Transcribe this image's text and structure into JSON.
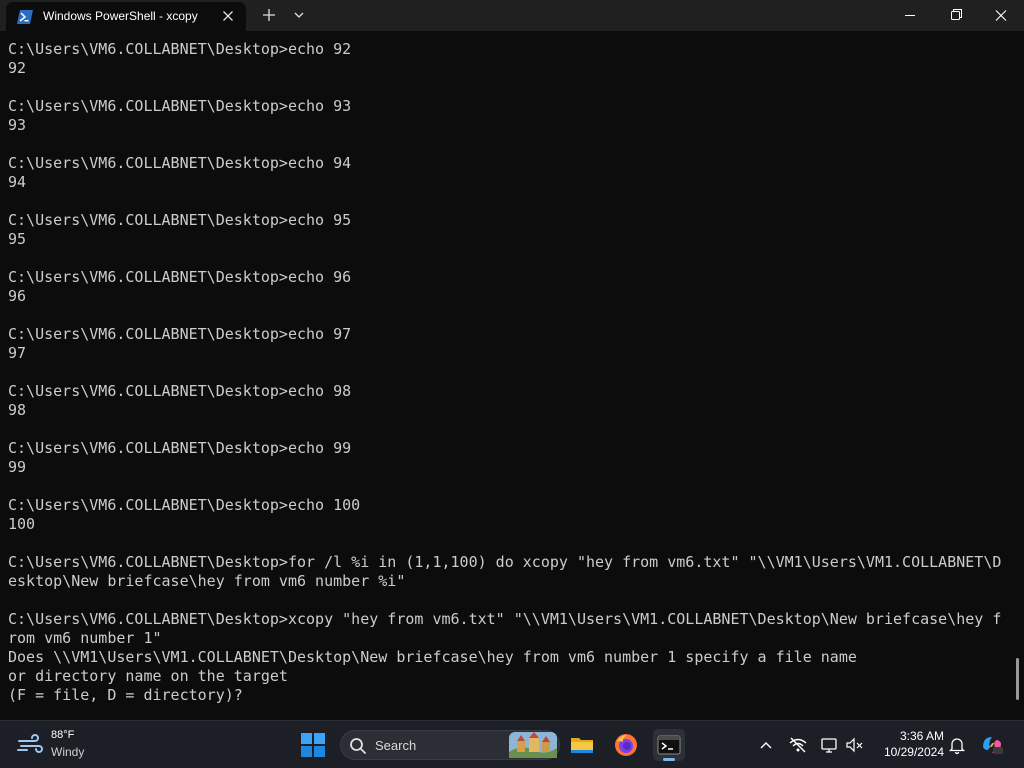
{
  "window": {
    "tab_title": "Windows PowerShell - xcopy",
    "new_tab_symbol": "+",
    "dropdown_symbol": "⌄"
  },
  "terminal": {
    "lines": [
      "C:\\Users\\VM6.COLLABNET\\Desktop>echo 92",
      "92",
      "",
      "C:\\Users\\VM6.COLLABNET\\Desktop>echo 93",
      "93",
      "",
      "C:\\Users\\VM6.COLLABNET\\Desktop>echo 94",
      "94",
      "",
      "C:\\Users\\VM6.COLLABNET\\Desktop>echo 95",
      "95",
      "",
      "C:\\Users\\VM6.COLLABNET\\Desktop>echo 96",
      "96",
      "",
      "C:\\Users\\VM6.COLLABNET\\Desktop>echo 97",
      "97",
      "",
      "C:\\Users\\VM6.COLLABNET\\Desktop>echo 98",
      "98",
      "",
      "C:\\Users\\VM6.COLLABNET\\Desktop>echo 99",
      "99",
      "",
      "C:\\Users\\VM6.COLLABNET\\Desktop>echo 100",
      "100",
      "",
      "C:\\Users\\VM6.COLLABNET\\Desktop>for /l %i in (1,1,100) do xcopy \"hey from vm6.txt\" \"\\\\VM1\\Users\\VM1.COLLABNET\\D",
      "esktop\\New briefcase\\hey from vm6 number %i\"",
      "",
      "C:\\Users\\VM6.COLLABNET\\Desktop>xcopy \"hey from vm6.txt\" \"\\\\VM1\\Users\\VM1.COLLABNET\\Desktop\\New briefcase\\hey f",
      "rom vm6 number 1\"",
      "Does \\\\VM1\\Users\\VM1.COLLABNET\\Desktop\\New briefcase\\hey from vm6 number 1 specify a file name",
      "or directory name on the target",
      "(F = file, D = directory)?"
    ]
  },
  "taskbar": {
    "weather": {
      "temp": "88°F",
      "condition": "Windy"
    },
    "search_placeholder": "Search",
    "clock": {
      "time": "3:36 AM",
      "date": "10/29/2024"
    },
    "apps": [
      "start-icon",
      "file-explorer-icon",
      "firefox-icon",
      "terminal-icon"
    ],
    "tray_icons": [
      "chevron-up-icon",
      "network-off-icon",
      "display-icon",
      "volume-muted-icon",
      "bell-icon",
      "copilot-icon"
    ]
  },
  "colors": {
    "terminal_bg": "#0c0c0c",
    "terminal_fg": "#cccccc",
    "titlebar_bg": "#202020",
    "taskbar_bg": "#1c1f26",
    "accent": "#0078d4"
  }
}
